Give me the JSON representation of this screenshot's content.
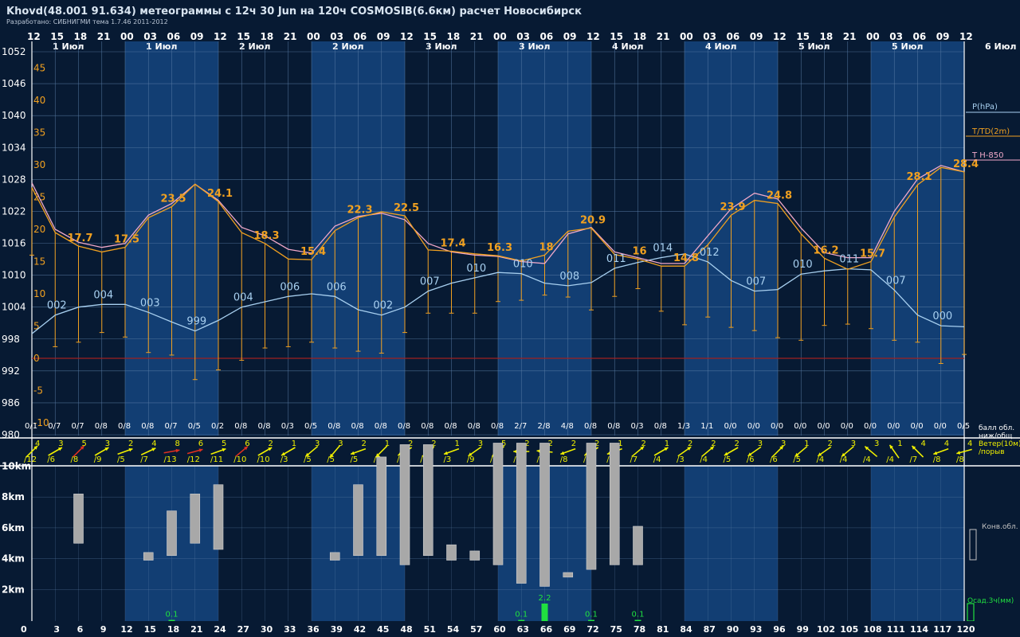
{
  "header": {
    "title": "Khovd(48.001 91.634) метеограммы с  12ч 30 Jun на 120ч COSMOSIB(6.6км) расчет Новосибирск",
    "credit": "Разработано: СИБНИГМИ тема 1.7.46 2011-2012"
  },
  "chart_data": {
    "type": "line",
    "hours": [
      "12",
      "15",
      "18",
      "21",
      "00",
      "03",
      "06",
      "09",
      "12",
      "15",
      "18",
      "21",
      "00",
      "03",
      "06",
      "09",
      "12",
      "15",
      "18",
      "21",
      "00",
      "03",
      "06",
      "09",
      "12",
      "15",
      "18",
      "21",
      "00",
      "03",
      "06",
      "09",
      "12",
      "15",
      "18",
      "21",
      "00",
      "03",
      "06",
      "09",
      "12"
    ],
    "days": [
      "1 Июл",
      "1 Июл",
      "2 Июл",
      "2 Июл",
      "3 Июл",
      "3 Июл",
      "4 Июл",
      "4 Июл",
      "5 Июл",
      "5 Июл",
      "6 Июл"
    ],
    "lead_hours": [
      0,
      3,
      6,
      9,
      12,
      15,
      18,
      21,
      24,
      27,
      30,
      33,
      36,
      39,
      42,
      45,
      48,
      51,
      54,
      57,
      60,
      63,
      66,
      69,
      72,
      75,
      78,
      81,
      84,
      87,
      90,
      93,
      96,
      99,
      102,
      105,
      108,
      111,
      114,
      117,
      120
    ],
    "pressure_axis": {
      "ticks": [
        "1052",
        "1046",
        "1040",
        "1034",
        "1028",
        "1022",
        "1016",
        "1010",
        "1004",
        "998",
        "992",
        "986",
        "980"
      ]
    },
    "temp_axis": {
      "ticks": [
        "45",
        "40",
        "35",
        "30",
        "25",
        "20",
        "15",
        "10",
        "5",
        "0",
        "-5",
        "-10"
      ]
    },
    "series": [
      {
        "name": "P(hPa)",
        "color": "#a8d0f0",
        "values": [
          999.0,
          1002.5,
          1004.0,
          1004.5,
          1004.5,
          1003.0,
          1001.2,
          999.5,
          1001.5,
          1004.0,
          1005.0,
          1006.0,
          1006.5,
          1006.0,
          1003.5,
          1002.5,
          1004.0,
          1007.0,
          1008.5,
          1009.5,
          1010.5,
          1010.3,
          1008.5,
          1008.0,
          1008.6,
          1011.3,
          1012.4,
          1013.3,
          1014.0,
          1012.5,
          1009.0,
          1007.0,
          1007.3,
          1010.2,
          1010.8,
          1011.2,
          1011.0,
          1007.2,
          1002.5,
          1000.5,
          1000.3
        ]
      },
      {
        "name": "T/TD(2m)",
        "color": "#f0a020",
        "values": [
          26.5,
          19.5,
          17.4,
          16.5,
          17.2,
          21.8,
          23.5,
          27.0,
          24.3,
          19.5,
          17.8,
          15.4,
          15.3,
          19.8,
          21.8,
          22.7,
          22.1,
          16.8,
          16.6,
          16.2,
          15.9,
          15.1,
          16.0,
          19.7,
          20.2,
          16.1,
          15.4,
          14.3,
          14.3,
          17.6,
          22.2,
          24.5,
          24.0,
          19.3,
          15.5,
          13.8,
          15.0,
          21.9,
          26.9,
          29.6,
          28.9
        ]
      },
      {
        "name": "T H-850",
        "color": "#f0a8c8",
        "values": [
          27.2,
          20.0,
          18.0,
          17.2,
          17.8,
          22.2,
          24.0,
          27.0,
          24.5,
          20.3,
          19.0,
          16.9,
          16.3,
          20.5,
          22.0,
          22.5,
          21.5,
          17.8,
          16.5,
          16.0,
          15.8,
          15.0,
          14.7,
          19.3,
          20.3,
          16.5,
          15.6,
          14.7,
          14.7,
          19.0,
          23.2,
          25.6,
          24.7,
          20.2,
          16.4,
          15.6,
          15.6,
          22.8,
          27.8,
          29.9,
          28.9
        ]
      }
    ],
    "temp_labels": [
      {
        "i": 2,
        "text": "17.7"
      },
      {
        "i": 4,
        "text": "17.5"
      },
      {
        "i": 6,
        "text": "23.5"
      },
      {
        "i": 8,
        "text": "24.1"
      },
      {
        "i": 10,
        "text": "18.3"
      },
      {
        "i": 12,
        "text": "15.4"
      },
      {
        "i": 14,
        "text": "22.3"
      },
      {
        "i": 16,
        "text": "22.5"
      },
      {
        "i": 18,
        "text": "17.4"
      },
      {
        "i": 20,
        "text": "16.3"
      },
      {
        "i": 22,
        "text": "18"
      },
      {
        "i": 24,
        "text": "20.9"
      },
      {
        "i": 26,
        "text": "16"
      },
      {
        "i": 28,
        "text": "14.8"
      },
      {
        "i": 30,
        "text": "23.9"
      },
      {
        "i": 32,
        "text": "24.8"
      },
      {
        "i": 34,
        "text": "16.2"
      },
      {
        "i": 36,
        "text": "15.7"
      },
      {
        "i": 38,
        "text": "28.1"
      },
      {
        "i": 40,
        "text": "28.4"
      }
    ],
    "pressure_labels": [
      {
        "i": 1,
        "text": "002"
      },
      {
        "i": 3,
        "text": "004"
      },
      {
        "i": 5,
        "text": "003"
      },
      {
        "i": 7,
        "text": "999"
      },
      {
        "i": 9,
        "text": "004"
      },
      {
        "i": 11,
        "text": "006"
      },
      {
        "i": 13,
        "text": "006"
      },
      {
        "i": 15,
        "text": "002"
      },
      {
        "i": 17,
        "text": "007"
      },
      {
        "i": 19,
        "text": "010"
      },
      {
        "i": 21,
        "text": "010"
      },
      {
        "i": 23,
        "text": "008"
      },
      {
        "i": 25,
        "text": "011"
      },
      {
        "i": 27,
        "text": "014"
      },
      {
        "i": 29,
        "text": "012"
      },
      {
        "i": 31,
        "text": "007"
      },
      {
        "i": 33,
        "text": "010"
      },
      {
        "i": 35,
        "text": "011"
      },
      {
        "i": 37,
        "text": "007"
      },
      {
        "i": 39,
        "text": "000"
      }
    ],
    "dew_point_drop_to": [
      16,
      1.8,
      2.5,
      4,
      3.3,
      0.9,
      0.5,
      -3.3,
      -1.8,
      -0.3,
      1.6,
      1.8,
      2.5,
      1.6,
      1.1,
      0.8,
      4,
      7,
      7,
      7,
      8.8,
      9,
      9.8,
      9.5,
      7.5,
      9.6,
      10.8,
      7.3,
      5.2,
      6.4,
      4.8,
      4.3,
      3.2,
      2.8,
      5.1,
      5.3,
      4.6,
      2.8,
      2.5,
      -0.8,
      0.6
    ],
    "cloud_cover": [
      "0/1",
      "0/7",
      "0/7",
      "0/8",
      "0/8",
      "0/8",
      "0/7",
      "0/5",
      "0/2",
      "0/8",
      "0/8",
      "0/3",
      "0/5",
      "0/8",
      "0/8",
      "0/8",
      "0/8",
      "0/8",
      "0/8",
      "0/8",
      "0/8",
      "2/7",
      "2/8",
      "4/8",
      "0/8",
      "0/8",
      "0/3",
      "0/8",
      "1/3",
      "1/1",
      "0/0",
      "0/0",
      "0/0",
      "0/0",
      "0/0",
      "0/0",
      "0/0",
      "0/0",
      "0/0",
      "0/0",
      "0/5"
    ],
    "wind": [
      {
        "speed": "4",
        "gust": "/12",
        "dir": 45,
        "strong": false
      },
      {
        "speed": "3",
        "gust": "/6",
        "dir": 30,
        "strong": false
      },
      {
        "speed": "5",
        "gust": "/8",
        "dir": 45,
        "strong": true
      },
      {
        "speed": "3",
        "gust": "/9",
        "dir": 30,
        "strong": false
      },
      {
        "speed": "2",
        "gust": "/5",
        "dir": 20,
        "strong": false
      },
      {
        "speed": "4",
        "gust": "/7",
        "dir": 25,
        "strong": false
      },
      {
        "speed": "8",
        "gust": "/13",
        "dir": 10,
        "strong": true
      },
      {
        "speed": "6",
        "gust": "/12",
        "dir": 15,
        "strong": true
      },
      {
        "speed": "5",
        "gust": "/11",
        "dir": 20,
        "strong": false
      },
      {
        "speed": "6",
        "gust": "/10",
        "dir": 40,
        "strong": true
      },
      {
        "speed": "2",
        "gust": "/10",
        "dir": 30,
        "strong": false
      },
      {
        "speed": "1",
        "gust": "/3",
        "dir": 210,
        "strong": false
      },
      {
        "speed": "3",
        "gust": "/5",
        "dir": 220,
        "strong": false
      },
      {
        "speed": "3",
        "gust": "/5",
        "dir": 230,
        "strong": false
      },
      {
        "speed": "2",
        "gust": "/5",
        "dir": 200,
        "strong": false
      },
      {
        "speed": "1",
        "gust": "/5",
        "dir": 225,
        "strong": false
      },
      {
        "speed": "2",
        "gust": "/5",
        "dir": 210,
        "strong": false
      },
      {
        "speed": "2",
        "gust": "/4",
        "dir": 40,
        "strong": false
      },
      {
        "speed": "1",
        "gust": "/3",
        "dir": 200,
        "strong": false
      },
      {
        "speed": "3",
        "gust": "/9",
        "dir": 215,
        "strong": false
      },
      {
        "speed": "5",
        "gust": "/8",
        "dir": 220,
        "strong": false
      },
      {
        "speed": "2",
        "gust": "/8",
        "dir": 180,
        "strong": false
      },
      {
        "speed": "2",
        "gust": "/8",
        "dir": 175,
        "strong": false
      },
      {
        "speed": "2",
        "gust": "/8",
        "dir": 200,
        "strong": false
      },
      {
        "speed": "2",
        "gust": "/4",
        "dir": 210,
        "strong": false
      },
      {
        "speed": "1",
        "gust": "/12",
        "dir": 200,
        "strong": false
      },
      {
        "speed": "2",
        "gust": "/7",
        "dir": 40,
        "strong": false
      },
      {
        "speed": "1",
        "gust": "/4",
        "dir": 30,
        "strong": false
      },
      {
        "speed": "2",
        "gust": "/3",
        "dir": 35,
        "strong": false
      },
      {
        "speed": "2",
        "gust": "/4",
        "dir": 40,
        "strong": false
      },
      {
        "speed": "2",
        "gust": "/5",
        "dir": 210,
        "strong": false
      },
      {
        "speed": "3",
        "gust": "/6",
        "dir": 215,
        "strong": false
      },
      {
        "speed": "3",
        "gust": "/6",
        "dir": 45,
        "strong": false
      },
      {
        "speed": "1",
        "gust": "/5",
        "dir": 220,
        "strong": false
      },
      {
        "speed": "2",
        "gust": "/4",
        "dir": 215,
        "strong": false
      },
      {
        "speed": "3",
        "gust": "/4",
        "dir": 220,
        "strong": false
      },
      {
        "speed": "3",
        "gust": "/4",
        "dir": 140,
        "strong": false
      },
      {
        "speed": "1",
        "gust": "/4",
        "dir": 125,
        "strong": false
      },
      {
        "speed": "4",
        "gust": "/7",
        "dir": 135,
        "strong": false
      },
      {
        "speed": "4",
        "gust": "/8",
        "dir": 200,
        "strong": false
      },
      {
        "speed": "4",
        "gust": "/8",
        "dir": 195,
        "strong": false
      }
    ],
    "conv_clouds": [
      null,
      null,
      [
        5.0,
        8.2
      ],
      null,
      null,
      [
        3.9,
        4.4
      ],
      [
        4.2,
        7.1
      ],
      [
        5.0,
        8.2
      ],
      [
        4.6,
        8.8
      ],
      null,
      null,
      null,
      null,
      [
        3.9,
        4.4
      ],
      [
        4.2,
        8.8
      ],
      [
        4.2,
        10.6
      ],
      [
        3.6,
        11.4
      ],
      [
        4.2,
        11.4
      ],
      [
        3.9,
        4.9
      ],
      [
        3.9,
        4.5
      ],
      [
        3.6,
        11.5
      ],
      [
        2.4,
        11.5
      ],
      [
        2.2,
        11.5
      ],
      [
        2.8,
        3.1
      ],
      [
        3.3,
        11.5
      ],
      [
        3.6,
        11.5
      ],
      [
        3.6,
        6.1
      ],
      null,
      null,
      null,
      null,
      null,
      null,
      null,
      null,
      null,
      null,
      null,
      null,
      null,
      null
    ],
    "precip": [
      {
        "i": 6,
        "value": 0.1,
        "text": "0.1"
      },
      {
        "i": 21,
        "value": 0.1,
        "text": "0.1"
      },
      {
        "i": 22,
        "value": 2.2,
        "text": "2.2"
      },
      {
        "i": 24,
        "value": 0.1,
        "text": "0.1"
      },
      {
        "i": 26,
        "value": 0.1,
        "text": "0.1"
      }
    ],
    "km_axis": {
      "ticks": [
        "10km",
        "8km",
        "6km",
        "4km",
        "2km"
      ]
    },
    "legend": {
      "pressure": "P(hPa)",
      "temperature": "T/TD(2m)",
      "t850": "T H-850",
      "cloud_line1": "балл обл.",
      "cloud_line2": "ниж/общ",
      "wind_line1": "Ветер(10м)",
      "wind_line2": "/порыв",
      "conv": "Конв.обл.",
      "precip": "Осад.3ч(мм)"
    },
    "colors": {
      "background_dark": "#071a33",
      "band_blue": "#123e73",
      "grid": "#5b7ea6",
      "pressure": "#a8d0f0",
      "temperature": "#f0a020",
      "t850": "#f0a8c8",
      "zero_line": "#a02020",
      "wind": "#f0f000",
      "wind_strong": "#e03020",
      "precip": "#20e040",
      "cloud_bar": "#a8a8a8"
    }
  }
}
